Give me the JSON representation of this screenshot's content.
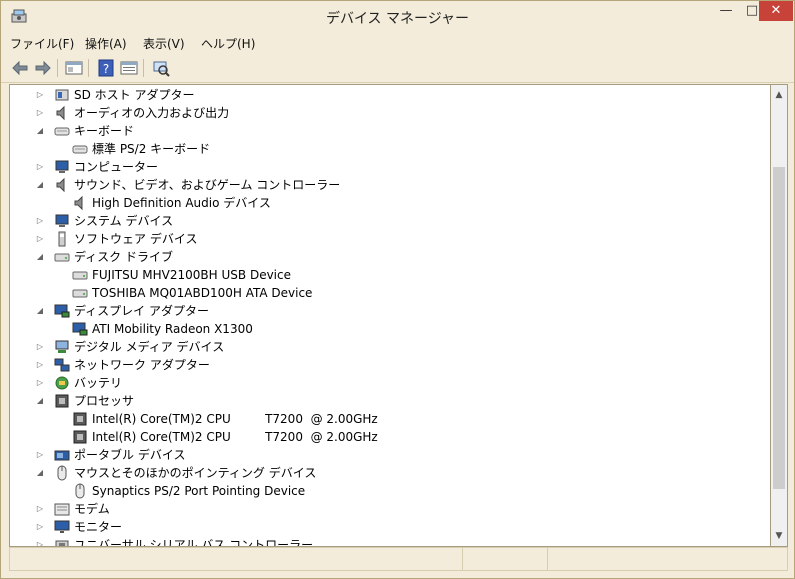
{
  "window": {
    "title": "デバイス マネージャー",
    "min_glyph": "—",
    "max_glyph": "□",
    "close_glyph": "✕"
  },
  "menu": [
    "ファイル(F)",
    "操作(A)",
    "表示(V)",
    "ヘルプ(H)"
  ],
  "toolbar": [
    "back-arrow-icon",
    "forward-arrow-icon",
    "properties-icon",
    "help-icon",
    "console-tree-icon",
    "scan-hardware-icon"
  ],
  "tree": [
    {
      "label": "SD ホスト アダプター",
      "level": 0,
      "state": "collapsed",
      "icon": "sd-host-icon"
    },
    {
      "label": "オーディオの入力および出力",
      "level": 0,
      "state": "collapsed",
      "icon": "speaker-icon"
    },
    {
      "label": "キーボード",
      "level": 0,
      "state": "expanded",
      "icon": "keyboard-icon"
    },
    {
      "label": "標準 PS/2 キーボード",
      "level": 1,
      "state": "leaf",
      "icon": "keyboard-icon"
    },
    {
      "label": "コンピューター",
      "level": 0,
      "state": "collapsed",
      "icon": "computer-icon"
    },
    {
      "label": "サウンド、ビデオ、およびゲーム コントローラー",
      "level": 0,
      "state": "expanded",
      "icon": "speaker-icon"
    },
    {
      "label": "High Definition Audio デバイス",
      "level": 1,
      "state": "leaf",
      "icon": "speaker-icon"
    },
    {
      "label": "システム デバイス",
      "level": 0,
      "state": "collapsed",
      "icon": "computer-icon"
    },
    {
      "label": "ソフトウェア デバイス",
      "level": 0,
      "state": "collapsed",
      "icon": "software-device-icon"
    },
    {
      "label": "ディスク ドライブ",
      "level": 0,
      "state": "expanded",
      "icon": "disk-icon"
    },
    {
      "label": "FUJITSU MHV2100BH USB Device",
      "level": 1,
      "state": "leaf",
      "icon": "disk-icon"
    },
    {
      "label": "TOSHIBA MQ01ABD100H ATA Device",
      "level": 1,
      "state": "leaf",
      "icon": "disk-icon"
    },
    {
      "label": "ディスプレイ アダプター",
      "level": 0,
      "state": "expanded",
      "icon": "display-adapter-icon"
    },
    {
      "label": "ATI Mobility Radeon X1300",
      "level": 1,
      "state": "leaf",
      "icon": "display-adapter-icon"
    },
    {
      "label": "デジタル メディア デバイス",
      "level": 0,
      "state": "collapsed",
      "icon": "media-device-icon"
    },
    {
      "label": "ネットワーク アダプター",
      "level": 0,
      "state": "collapsed",
      "icon": "network-icon"
    },
    {
      "label": "バッテリ",
      "level": 0,
      "state": "collapsed",
      "icon": "battery-icon"
    },
    {
      "label": "プロセッサ",
      "level": 0,
      "state": "expanded",
      "icon": "processor-icon"
    },
    {
      "label": "Intel(R) Core(TM)2 CPU         T7200  @ 2.00GHz",
      "level": 1,
      "state": "leaf",
      "icon": "processor-icon"
    },
    {
      "label": "Intel(R) Core(TM)2 CPU         T7200  @ 2.00GHz",
      "level": 1,
      "state": "leaf",
      "icon": "processor-icon"
    },
    {
      "label": "ポータブル デバイス",
      "level": 0,
      "state": "collapsed",
      "icon": "portable-device-icon"
    },
    {
      "label": "マウスとそのほかのポインティング デバイス",
      "level": 0,
      "state": "expanded",
      "icon": "mouse-icon"
    },
    {
      "label": "Synaptics PS/2 Port Pointing Device",
      "level": 1,
      "state": "leaf",
      "icon": "mouse-icon"
    },
    {
      "label": "モデム",
      "level": 0,
      "state": "collapsed",
      "icon": "modem-icon"
    },
    {
      "label": "モニター",
      "level": 0,
      "state": "collapsed",
      "icon": "monitor-icon"
    },
    {
      "label": "ユニバーサル シリアル バス コントローラー",
      "level": 0,
      "state": "collapsed",
      "icon": "usb-icon"
    }
  ],
  "colors": {
    "chrome": "#f3ecda",
    "close": "#c7433a",
    "tree_bg": "#ffffff"
  }
}
